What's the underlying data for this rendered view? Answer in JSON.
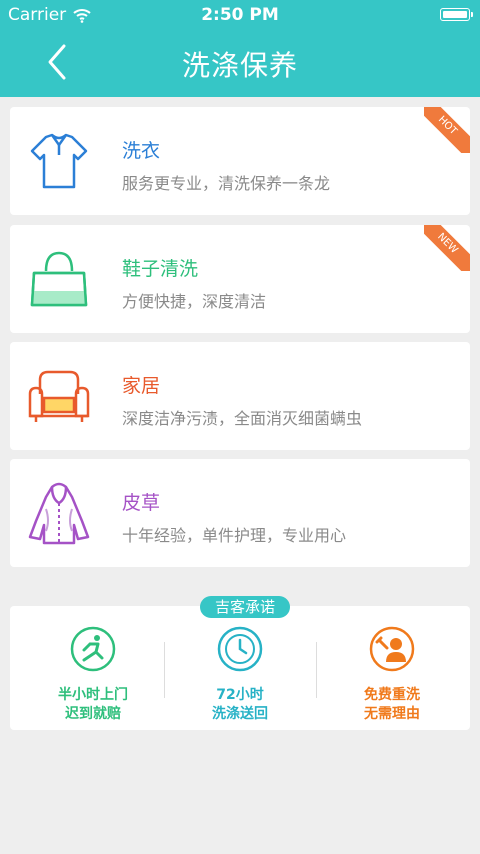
{
  "status_bar": {
    "carrier": "Carrier",
    "time": "2:50 PM"
  },
  "header": {
    "title": "洗涤保养"
  },
  "services": [
    {
      "title": "洗衣",
      "subtitle": "服务更专业，清洗保养一条龙",
      "badge": "HOT",
      "icon": "shirt-icon",
      "color": "#2b7fd6"
    },
    {
      "title": "鞋子清洗",
      "subtitle": "方便快捷，深度清洁",
      "badge": "NEW",
      "icon": "bag-icon",
      "color": "#2ebf7c"
    },
    {
      "title": "家居",
      "subtitle": "深度洁净污渍，全面消灭细菌螨虫",
      "badge": "",
      "icon": "armchair-icon",
      "color": "#e85a2c"
    },
    {
      "title": "皮草",
      "subtitle": "十年经验，单件护理，专业用心",
      "badge": "",
      "icon": "coat-icon",
      "color": "#a552c6"
    }
  ],
  "promise": {
    "tag": "吉客承诺",
    "items": [
      {
        "line1": "半小时上门",
        "line2": "迟到就赔",
        "icon": "running-person-icon",
        "color": "#2ebf7c"
      },
      {
        "line1": "72小时",
        "line2": "洗涤送回",
        "icon": "clock-icon",
        "color": "#27b2c6"
      },
      {
        "line1": "免费重洗",
        "line2": "无需理由",
        "icon": "wrench-person-icon",
        "color": "#f07a1c"
      }
    ]
  }
}
